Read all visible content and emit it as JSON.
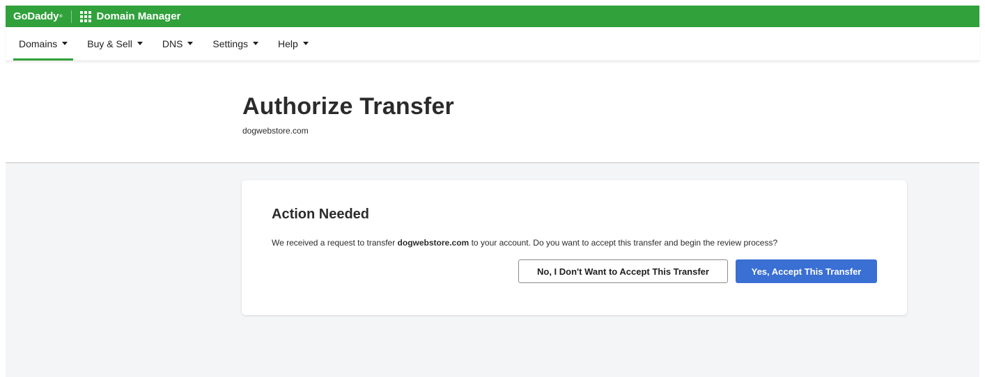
{
  "topbar": {
    "brand": "GoDaddy",
    "app_icon": "apps-grid-icon",
    "app_name": "Domain Manager",
    "accent": "#30a13b"
  },
  "nav": {
    "items": [
      {
        "label": "Domains",
        "active": true
      },
      {
        "label": "Buy & Sell",
        "active": false
      },
      {
        "label": "DNS",
        "active": false
      },
      {
        "label": "Settings",
        "active": false
      },
      {
        "label": "Help",
        "active": false
      }
    ]
  },
  "header": {
    "title": "Authorize Transfer",
    "subtitle": "dogwebstore.com"
  },
  "card": {
    "title": "Action Needed",
    "text_before": "We received a request to transfer ",
    "domain": "dogwebstore.com",
    "text_after": " to your account. Do you want to accept this transfer and begin the review process?",
    "decline_label": "No, I Don't Want to Accept This Transfer",
    "accept_label": "Yes, Accept This Transfer",
    "accept_color": "#3a6fd4"
  }
}
